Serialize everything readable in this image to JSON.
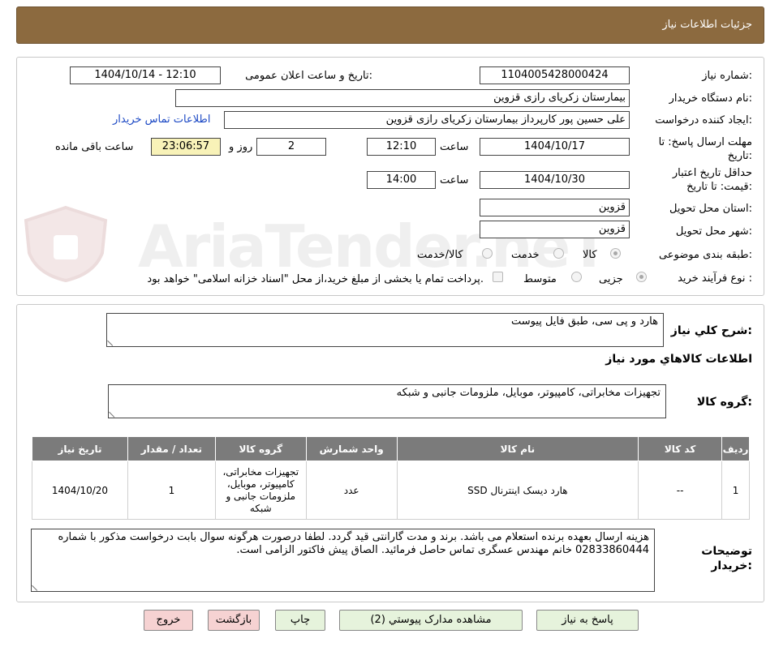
{
  "header": {
    "title": "جزئیات اطلاعات نیاز"
  },
  "watermark": "AriaTender.neT",
  "fields": {
    "need_number_label": "شماره نیاز:",
    "need_number": "1104005428000424",
    "announce_label": "تاریخ و ساعت اعلان عمومی:",
    "announce_value": "1404/10/14 - 12:10",
    "buyer_label": "نام دستگاه خریدار:",
    "buyer_value": "بیمارستان زکریای رازی قزوین",
    "creator_label": "ایجاد کننده درخواست:",
    "creator_value": "علی حسین پور کارپرداز بیمارستان زکریای رازی قزوین",
    "contact_link": "اطلاعات تماس خریدار",
    "deadline_label": "مهلت ارسال پاسخ: تا تاریخ:",
    "deadline_date": "1404/10/17",
    "time_label": "ساعت",
    "deadline_time": "12:10",
    "days_value": "2",
    "days_label": "روز و",
    "remaining_value": "23:06:57",
    "remaining_label": "ساعت باقی مانده",
    "validity_label": "حداقل تاریخ اعتبار قیمت: تا تاریخ:",
    "validity_date": "1404/10/30",
    "validity_time": "14:00",
    "province_label": "استان محل تحویل:",
    "province_value": "قزوین",
    "city_label": "شهر محل تحویل:",
    "city_value": "قزوین",
    "category_label": "طبقه بندی موضوعی:",
    "category_options": [
      "کالا",
      "خدمت",
      "کالا/خدمت"
    ],
    "purchase_label": "نوع فرآیند خرید :",
    "purchase_options": [
      "جزیی",
      "متوسط"
    ],
    "payment_note": "پرداخت تمام یا بخشی از مبلغ خرید،از محل \"اسناد خزانه اسلامی\" خواهد بود."
  },
  "description": {
    "label": "شرح کلي نياز:",
    "value": "هارد و پی سی، طبق فایل پیوست"
  },
  "goods": {
    "section_title": "اطلاعات کالاهاي مورد نياز",
    "group_label": "گروه کالا:",
    "group_value": "تجهیزات مخابراتی، کامپیوتر، موبایل، ملزومات جانبی و شبکه"
  },
  "table": {
    "headers": [
      "ردیف",
      "کد کالا",
      "نام کالا",
      "واحد شمارش",
      "گروه کالا",
      "تعداد / مقدار",
      "تاریخ نیاز"
    ],
    "rows": [
      {
        "row": "1",
        "code": "--",
        "name": "هارد دیسک اینترنال SSD",
        "unit": "عدد",
        "group": "تجهیزات مخابراتی، کامپیوتر، موبایل، ملزومات جانبی و شبکه",
        "qty": "1",
        "date": "1404/10/20"
      }
    ]
  },
  "notes": {
    "label_line1": "توضیحات",
    "label_line2": "خریدار:",
    "value": "هزینه ارسال بعهده برنده استعلام می باشد. برند و مدت گارانتی قید گردد. لطفا درصورت هرگونه سوال بابت درخواست مذکور با شماره 02833860444 خانم مهندس عسگری تماس حاصل فرمائید. الصاق پیش فاکتور الزامی است."
  },
  "buttons": {
    "reply": "پاسخ به نیاز",
    "attachments": "مشاهده مدارک پیوستي (2)",
    "print": "چاپ",
    "back": "بازگشت",
    "exit": "خروج"
  }
}
